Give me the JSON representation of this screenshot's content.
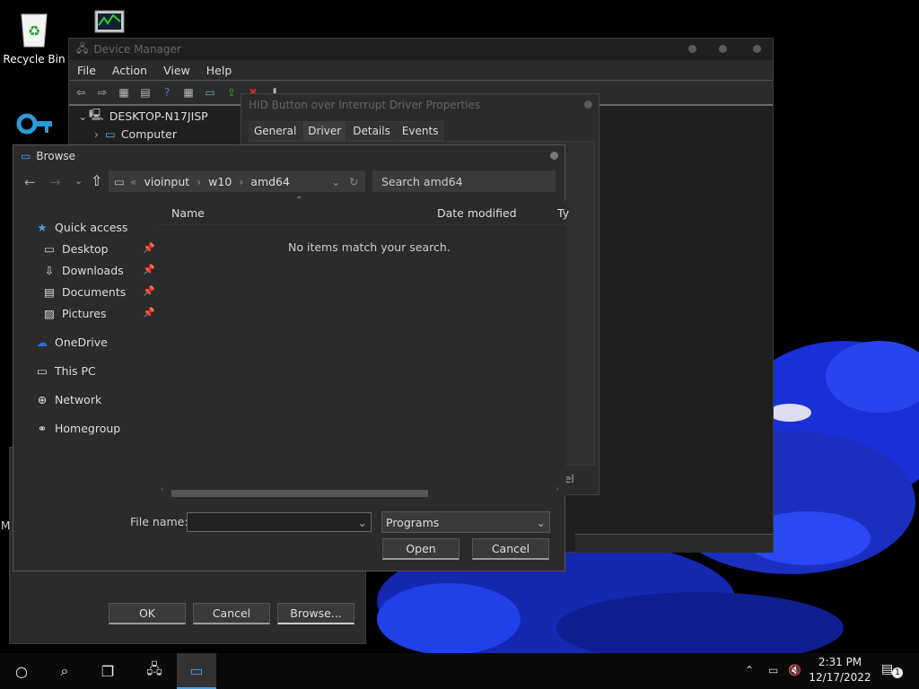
{
  "desktop": {
    "recycle_bin_label": "Recycle Bin"
  },
  "device_manager": {
    "title": "Device Manager",
    "menu": [
      "File",
      "Action",
      "View",
      "Help"
    ],
    "tree": {
      "root": "DESKTOP-N17JISP",
      "child": "Computer"
    }
  },
  "hid_properties": {
    "title": "HID Button over Interrupt Driver Properties",
    "tabs": [
      "General",
      "Driver",
      "Details",
      "Events"
    ],
    "active_tab": "Driver",
    "partial_text": "el"
  },
  "browse_dialog": {
    "title": "Browse",
    "breadcrumb": [
      "vioinput",
      "w10",
      "amd64"
    ],
    "search_placeholder": "Search amd64",
    "nav": {
      "quick_access": "Quick access",
      "desktop": "Desktop",
      "downloads": "Downloads",
      "documents": "Documents",
      "pictures": "Pictures",
      "onedrive": "OneDrive",
      "this_pc": "This PC",
      "network": "Network",
      "homegroup": "Homegroup"
    },
    "columns": {
      "name": "Name",
      "date_modified": "Date modified",
      "type_partial": "Ty"
    },
    "empty_message": "No items match your search.",
    "file_name_label": "File name:",
    "file_name_value": "",
    "file_type_value": "Programs",
    "open_label": "Open",
    "cancel_label": "Cancel"
  },
  "behind_dialog": {
    "ok_label": "OK",
    "cancel_label": "Cancel",
    "browse_label": "Browse...",
    "partial_letter": "M"
  },
  "taskbar": {
    "time": "2:31 PM",
    "date": "12/17/2022",
    "notification_count": "1"
  }
}
